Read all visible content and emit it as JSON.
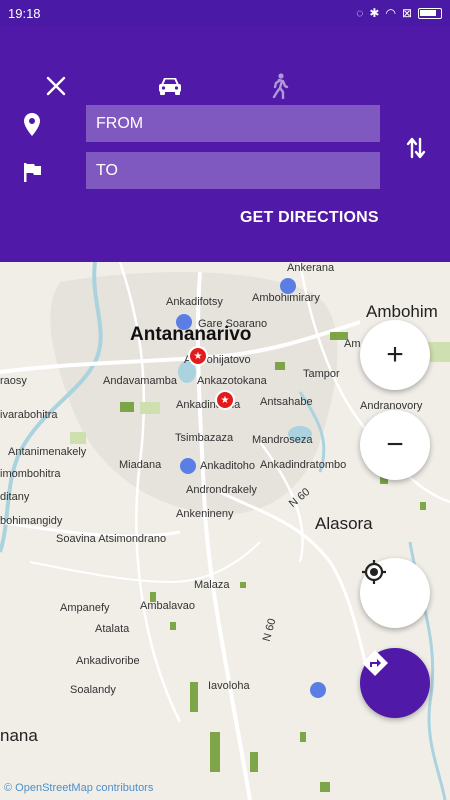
{
  "status_bar": {
    "time": "19:18"
  },
  "header": {
    "from_placeholder": "FROM",
    "to_placeholder": "TO",
    "get_directions": "GET DIRECTIONS"
  },
  "map": {
    "labels": {
      "antananarivo": "Antananarivo",
      "gare": "Gare Soarano",
      "ankerana": "Ankerana",
      "ankadifotsy": "Ankadifotsy",
      "ambohimirary": "Ambohimirary",
      "ambohim": "Ambohim",
      "ambohijatovo": "Ambohijatovo",
      "andavamamba": "Andavamamba",
      "ankazotokana": "Ankazotokana",
      "tamporana": "Tampor",
      "raosy": "raosy",
      "ankadindana": "Ankadindana",
      "antsahabe": "Antsahabe",
      "andranovory": "Andranovory",
      "avarabohitra": "ivarabohitra",
      "tsimbazaza": "Tsimbazaza",
      "mandroseza": "Mandroseza",
      "antanimenakely": "Antanimenakely",
      "miadana": "Miadana",
      "ankaditoho": "Ankaditoho",
      "ankadindratombo": "Ankadindratombo",
      "imombohitra": "imombohitra",
      "androndrakely": "Androndrakely",
      "ditany": "ditany",
      "ankenineny": "Ankenineny",
      "n60a": "N 60",
      "alasora": "Alasora",
      "bohimangidy": "bohimangidy",
      "soavina": "Soavina Atsimondrano",
      "malaza": "Malaza",
      "ampanefy": "Ampanefy",
      "ambalavao": "Ambalavao",
      "atalata": "Atalata",
      "n60b": "N 60",
      "ankadivorib": "Ankadivoribe",
      "soalandy": "Soalandy",
      "iavoloha": "Iavoloha",
      "nana": "nana",
      "am": "Am",
      "attribution": "© OpenStreetMap contributors"
    }
  },
  "fab": {
    "zoom_in": "+",
    "zoom_out": "−"
  },
  "colors": {
    "primary": "#5019a8",
    "status": "#4a1aa6",
    "pin": "#e21b1b",
    "water": "#aad3df",
    "park": "#6a9a2e"
  }
}
